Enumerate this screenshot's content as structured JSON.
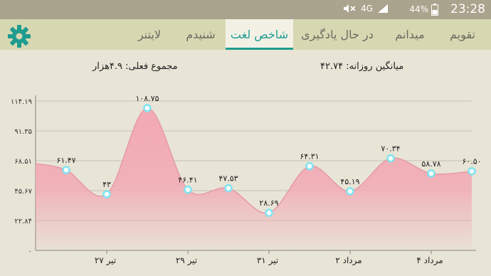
{
  "status_bar": {
    "network": "4G",
    "battery": "44%",
    "time": "23:28",
    "icons": [
      "mute-icon",
      "signal-icon",
      "battery-icon"
    ]
  },
  "app_bar": {
    "settings_icon": "gear-icon",
    "accent_color": "#1f9c8f",
    "tabs": [
      {
        "label": "تقویم"
      },
      {
        "label": "میدانم"
      },
      {
        "label": "در حال یادگیری"
      },
      {
        "label": "شاخص لغت",
        "active": true
      },
      {
        "label": "شنیدم"
      },
      {
        "label": "لایتنر"
      }
    ]
  },
  "summary": {
    "total": "مجموع فعلی: ۴.۹هزار",
    "daily_average": "میانگین روزانه: ۴۲.۷۴"
  },
  "chart_data": {
    "type": "area",
    "fill_color": "#f2a9b4",
    "marker_color": "#7fe4f0",
    "grid": true,
    "y_ticks": [
      "۱۱۴.۱۹",
      "۹۱.۳۵",
      "۶۸.۵۱",
      "۴۵.۶۷",
      "۲۲.۸۴",
      "۰"
    ],
    "ylim": [
      0,
      114.19
    ],
    "x_tick_labels": [
      "۲۷ تیر",
      "۲۹ تیر",
      "۳۱ تیر",
      "۲ مرداد",
      "۴ مرداد"
    ],
    "values": [
      66.3,
      61.47,
      43,
      108.75,
      46.41,
      47.53,
      28.69,
      64.31,
      45.19,
      70.34,
      58.78,
      60.5
    ],
    "point_labels": [
      "",
      "۶۱.۴۷",
      "۴۳",
      "۱۰۸.۷۵",
      "۴۶.۴۱",
      "۴۷.۵۳",
      "۲۸.۶۹",
      "۶۴.۳۱",
      "۴۵.۱۹",
      "۷۰.۳۴",
      "۵۸.۷۸",
      "۶۰.۵۰"
    ],
    "point_markers": [
      false,
      true,
      true,
      true,
      true,
      true,
      true,
      true,
      true,
      true,
      true,
      true
    ]
  }
}
